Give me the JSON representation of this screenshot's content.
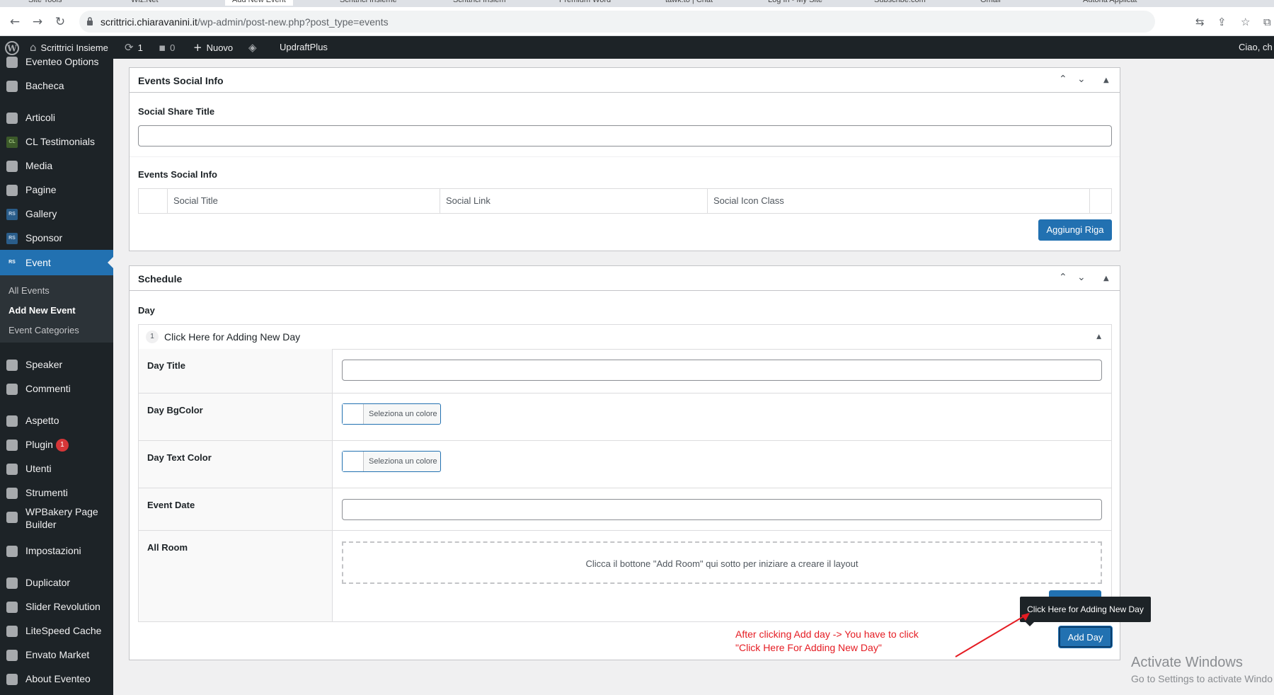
{
  "browser": {
    "tabs": [
      {
        "label": "Site Tools"
      },
      {
        "label": "Wiz.Net"
      },
      {
        "label": "Add New Event"
      },
      {
        "label": "Scrittrici Insieme"
      },
      {
        "label": "Scrittrici Insiem"
      },
      {
        "label": "Premium Word"
      },
      {
        "label": "tawk.to | Chat"
      },
      {
        "label": "Log In - My Site"
      },
      {
        "label": "Subscribe.com"
      },
      {
        "label": "Gmail"
      },
      {
        "label": "Autoria Applicat"
      }
    ],
    "url_domain": "scrittrici.chiaravanini.it",
    "url_path": "/wp-admin/post-new.php?post_type=events"
  },
  "adminbar": {
    "site_name": "Scrittrici Insieme",
    "updates_count": "1",
    "comments_count": "0",
    "new_label": "Nuovo",
    "plugin_label": "UpdraftPlus",
    "greeting": "Ciao, ch"
  },
  "sidebar": {
    "items": [
      {
        "label": "Eventeo Options"
      },
      {
        "label": "Bacheca"
      },
      {
        "label": "Articoli"
      },
      {
        "label": "CL Testimonials"
      },
      {
        "label": "Media"
      },
      {
        "label": "Pagine"
      },
      {
        "label": "Gallery"
      },
      {
        "label": "Sponsor"
      },
      {
        "label": "Event"
      },
      {
        "label": "Speaker"
      },
      {
        "label": "Commenti"
      },
      {
        "label": "Aspetto"
      },
      {
        "label": "Plugin"
      },
      {
        "label": "Utenti"
      },
      {
        "label": "Strumenti"
      },
      {
        "label": "WPBakery Page Builder"
      },
      {
        "label": "Impostazioni"
      },
      {
        "label": "Duplicator"
      },
      {
        "label": "Slider Revolution"
      },
      {
        "label": "LiteSpeed Cache"
      },
      {
        "label": "Envato Market"
      },
      {
        "label": "About Eventeo"
      }
    ],
    "event_submenu": [
      "All Events",
      "Add New Event",
      "Event Categories"
    ],
    "plugin_badge": "1"
  },
  "social_box": {
    "title": "Events Social Info",
    "share_title_label": "Social Share Title",
    "share_title_value": "",
    "social_info_label": "Events Social Info",
    "columns": [
      "Social Title",
      "Social Link",
      "Social Icon Class"
    ],
    "add_row_button": "Aggiungi Riga"
  },
  "schedule_box": {
    "title": "Schedule",
    "day_label": "Day",
    "accordion_number": "1",
    "accordion_title": "Click Here for Adding New Day",
    "day_title_label": "Day Title",
    "day_title_value": "",
    "day_bgcolor_label": "Day BgColor",
    "day_text_color_label": "Day Text Color",
    "color_button_text": "Seleziona un colore",
    "event_date_label": "Event Date",
    "event_date_value": "",
    "all_room_label": "All Room",
    "room_placeholder": "Clicca il bottone \"Add Room\" qui sotto per iniziare a creare il layout",
    "add_day_button": "Add Day"
  },
  "tooltip": {
    "text": "Click Here for Adding New Day"
  },
  "annotation": {
    "line1": "After clicking Add day -> You have to click",
    "line2": "\"Click Here For Adding New Day\"",
    "color": "#e51c23"
  },
  "windows_activation": {
    "title": "Activate Windows",
    "subtitle": "Go to Settings to activate Windo"
  },
  "colors": {
    "wp_blue": "#2271b1",
    "admin_dark": "#1d2327",
    "annotation_red": "#e51c23"
  }
}
